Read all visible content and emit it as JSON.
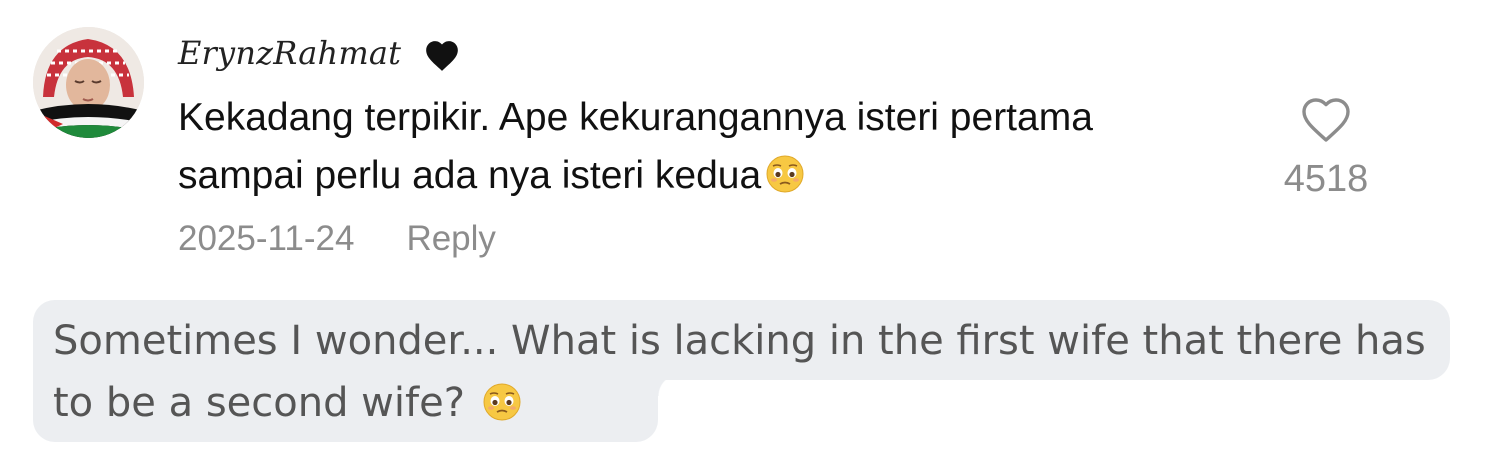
{
  "comment": {
    "username": "ErynzRahmat",
    "username_badge_icon": "black-heart-icon",
    "text": "Kekadang terpikir. Ape kekurangannya isteri pertama sampai perlu ada nya isteri kedua",
    "text_emoji_icon": "pleading-face-emoji",
    "date": "2025-11-24",
    "reply_label": "Reply",
    "like_count": "4518",
    "like_icon": "heart-outline-icon",
    "avatar_icon": "user-avatar"
  },
  "translation": {
    "text": "Sometimes I wonder... What is lacking in the first wife that there has to be a second wife?",
    "emoji_icon": "pleading-face-emoji",
    "background_color": "#eceef1"
  },
  "colors": {
    "text_primary": "#111111",
    "text_secondary": "#8c8c8c",
    "translation_text": "#555555"
  }
}
